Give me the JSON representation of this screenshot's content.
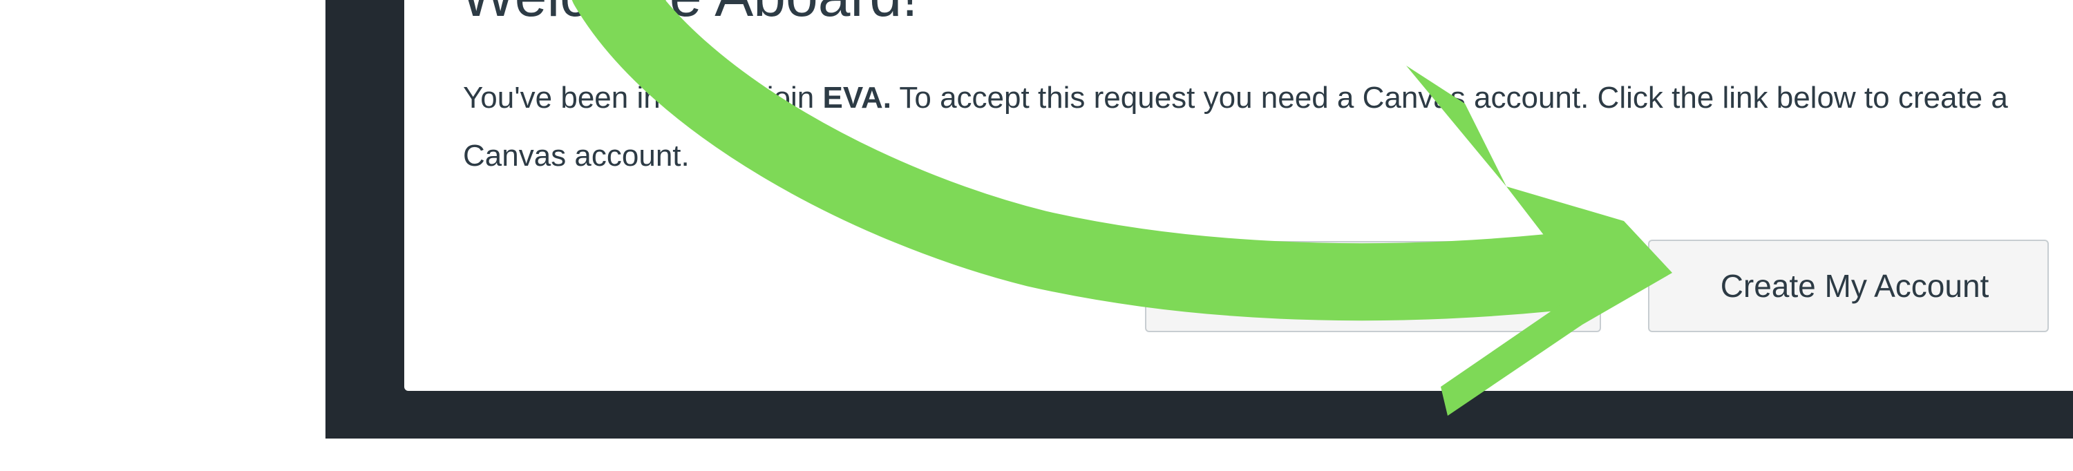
{
  "dialog": {
    "title": "Welcome Aboard!",
    "body_before_org": "You've been invited to join ",
    "org_name": "EVA.",
    "body_after_org": " To accept this request you need a Canvas account. Click the link below to create a Canvas account.",
    "create_account_button": "Create My Account"
  },
  "annotation": {
    "icon": "curved-arrow-icon",
    "color": "#7ed957"
  },
  "colors": {
    "backdrop": "#232a31",
    "text": "#2d3b45",
    "button_bg": "#f5f5f5",
    "button_border": "#c7cdd1"
  }
}
